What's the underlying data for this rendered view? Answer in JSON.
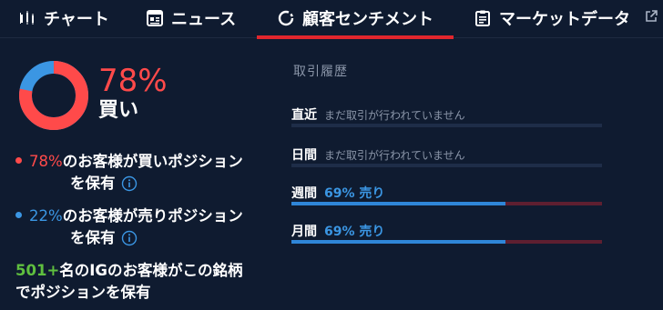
{
  "tabs": [
    {
      "label": "チャート",
      "icon": "chart-icon"
    },
    {
      "label": "ニュース",
      "icon": "news-icon"
    },
    {
      "label": "顧客センチメント",
      "icon": "sentiment-icon",
      "active": true
    },
    {
      "label": "マーケットデータ",
      "icon": "clipboard-icon"
    }
  ],
  "sentiment": {
    "headline_pct": "78%",
    "headline_label": "買い",
    "buy_fraction": 0.78,
    "colors": {
      "buy": "#ff4a4a",
      "sell": "#3b96e3",
      "accent": "#e1262d",
      "green": "#5fbf3f"
    },
    "buy_pct": "78%",
    "buy_text": "のお客様が買いポジション",
    "sell_pct": "22%",
    "sell_text": "のお客様が売りポジション",
    "hold_text": "を保有",
    "clients_count": "501+",
    "clients_text1": "名のIGのお客様がこの銘柄",
    "clients_text2": "でポジションを保有"
  },
  "trade_history": {
    "title": "取引履歴",
    "rows": [
      {
        "period": "直近",
        "note": "まだ取引が行われていません",
        "value": "",
        "sell_fraction": null
      },
      {
        "period": "日間",
        "note": "まだ取引が行われていません",
        "value": "",
        "sell_fraction": null
      },
      {
        "period": "週間",
        "note": "",
        "value": "69% 売り",
        "sell_fraction": 0.69
      },
      {
        "period": "月間",
        "note": "",
        "value": "69% 売り",
        "sell_fraction": 0.69
      }
    ]
  }
}
